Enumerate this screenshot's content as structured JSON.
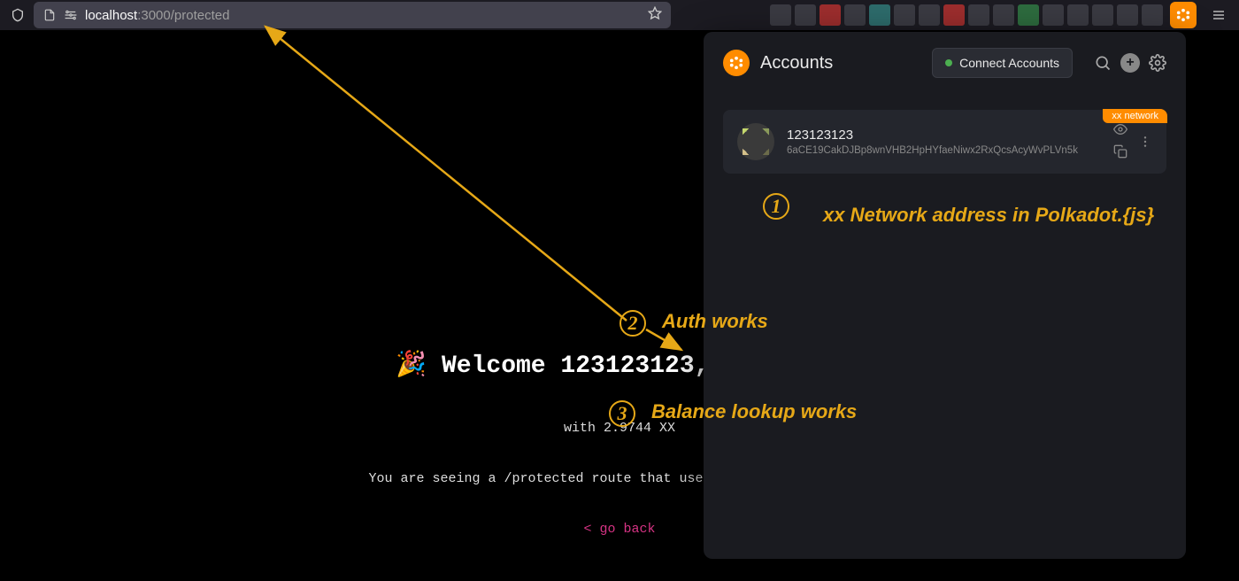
{
  "browser": {
    "url_host": "localhost",
    "url_port": ":3000",
    "url_path": "/protected"
  },
  "page": {
    "welcome_prefix": "🎉 Welcome ",
    "welcome_user": "123123123",
    "welcome_suffix": ", you pass",
    "balance_line": "with 2.9744 XX",
    "note_line": "You are seeing a /protected route that uses Server-Side Generat",
    "goback": "< go back"
  },
  "extension": {
    "title": "Accounts",
    "connect_label": "Connect Accounts",
    "account": {
      "name": "123123123",
      "address": "6aCE19CakDJBp8wnVHB2HpHYfaeNiwx2RxQcsAcyWvPLVn5k",
      "network_badge": "xx network"
    }
  },
  "annotations": {
    "one_label": "xx Network address in Polkadot.{js}",
    "two_label": "Auth works",
    "three_label": "Balance lookup works",
    "num1": "1",
    "num2": "2",
    "num3": "3"
  }
}
